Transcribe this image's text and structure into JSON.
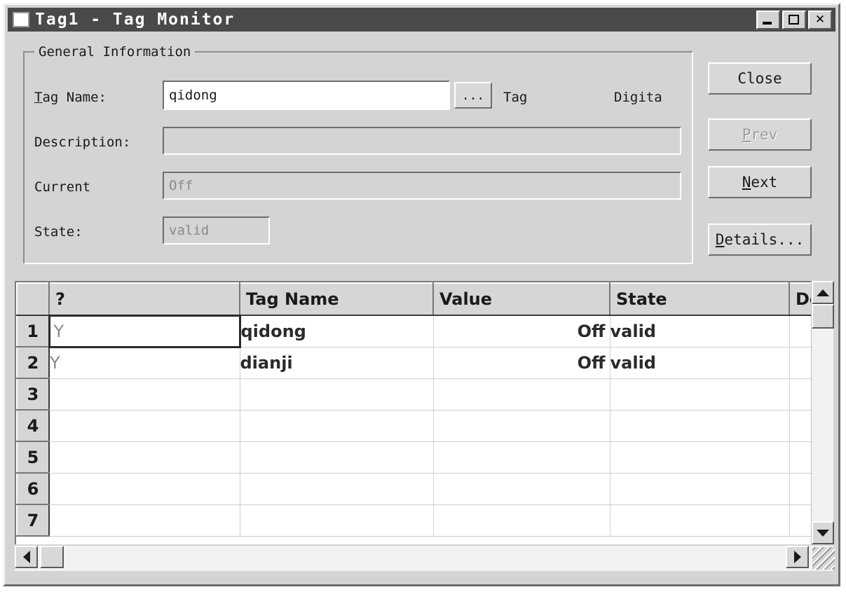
{
  "window": {
    "title": "Tag1 - Tag Monitor",
    "icon": "app-window-icon",
    "controls": {
      "minimize": "minimize-icon",
      "maximize": "maximize-icon",
      "close": "close-icon"
    }
  },
  "general_information": {
    "legend": "General Information",
    "tag_name": {
      "label_accel": "T",
      "label_rest": "ag Name:",
      "value": "qidong",
      "browse_label": "..."
    },
    "type_labels": {
      "kind": "Tag",
      "datatype": "Digita"
    },
    "description": {
      "label": "Description:",
      "value": ""
    },
    "current": {
      "label": "Current",
      "value": "Off"
    },
    "state": {
      "label": "State:",
      "value": "valid"
    }
  },
  "buttons": {
    "close": {
      "label": "Close",
      "enabled": true
    },
    "prev": {
      "accel": "P",
      "rest": "rev",
      "enabled": false
    },
    "next": {
      "accel": "N",
      "rest": "ext",
      "enabled": true
    },
    "details": {
      "accel": "D",
      "rest": "etails...",
      "enabled": true
    }
  },
  "grid": {
    "columns": [
      "",
      "?",
      "Tag Name",
      "Value",
      "State",
      "Descr"
    ],
    "row_numbers": [
      "1",
      "2",
      "3",
      "4",
      "5",
      "6",
      "7"
    ],
    "rows": [
      {
        "num": "1",
        "flag": "Y",
        "tag_name": "qidong",
        "value": "Off",
        "state": "valid",
        "description": ""
      },
      {
        "num": "2",
        "flag": "Y",
        "tag_name": "dianji",
        "value": "Off",
        "state": "valid",
        "description": ""
      },
      {
        "num": "3",
        "flag": "",
        "tag_name": "",
        "value": "",
        "state": "",
        "description": ""
      },
      {
        "num": "4",
        "flag": "",
        "tag_name": "",
        "value": "",
        "state": "",
        "description": ""
      },
      {
        "num": "5",
        "flag": "",
        "tag_name": "",
        "value": "",
        "state": "",
        "description": ""
      },
      {
        "num": "6",
        "flag": "",
        "tag_name": "",
        "value": "",
        "state": "",
        "description": ""
      },
      {
        "num": "7",
        "flag": "",
        "tag_name": "",
        "value": "",
        "state": "",
        "description": ""
      }
    ],
    "selected_cell": {
      "row": 1,
      "column": "?"
    }
  },
  "scrollbars": {
    "vertical": {
      "up_icon": "scroll-up-arrow-icon",
      "down_icon": "scroll-down-arrow-icon"
    },
    "horizontal": {
      "left_icon": "scroll-left-arrow-icon",
      "right_icon": "scroll-right-arrow-icon"
    },
    "resize_grip": "resize-grip-icon"
  },
  "colors": {
    "dialog_face": "#d4d4d4",
    "titlebar": "#4a4a4a",
    "field_bg": "#ffffff",
    "disabled_text": "#8a8a8a"
  }
}
